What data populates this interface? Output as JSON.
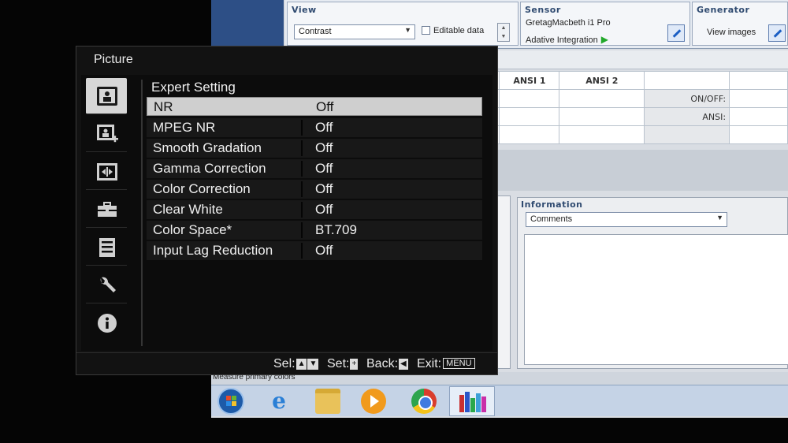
{
  "pc_app": {
    "view_group_title": "View",
    "view_select": "Contrast",
    "editable_label": "Editable data",
    "sensor_group_title": "Sensor",
    "sensor_name": "GretagMacbeth i1 Pro",
    "sensor_mode": "Adative Integration",
    "generator_group_title": "Generator",
    "view_images_label": "View images",
    "grid_headers": [
      "ANSI 1",
      "ANSI 2"
    ],
    "grid_label_onoff": "ON/OFF:",
    "grid_label_ansi": "ANSI:",
    "information_title": "Information",
    "comments_select": "Comments",
    "status_text": "Measure primary colors"
  },
  "taskbar": {
    "icons": [
      "windows-start-icon",
      "internet-explorer-icon",
      "folder-icon",
      "media-player-icon",
      "chrome-icon",
      "calibration-app-icon"
    ]
  },
  "osd": {
    "title": "Picture",
    "section": "Expert Setting",
    "sidebar_icons": [
      "picture-icon",
      "picture-add-icon",
      "screen-size-icon",
      "toolbox-icon",
      "checklist-icon",
      "wrench-icon",
      "info-icon"
    ],
    "items": [
      {
        "label": "NR",
        "value": "Off"
      },
      {
        "label": "MPEG NR",
        "value": "Off"
      },
      {
        "label": "Smooth Gradation",
        "value": "Off"
      },
      {
        "label": "Gamma Correction",
        "value": "Off"
      },
      {
        "label": "Color Correction",
        "value": "Off"
      },
      {
        "label": "Clear White",
        "value": "Off"
      },
      {
        "label": "Color Space*",
        "value": "BT.709"
      },
      {
        "label": "Input Lag Reduction",
        "value": "Off"
      }
    ],
    "selected_index": 0,
    "footer": {
      "sel": "Sel:",
      "set": "Set:",
      "back": "Back:",
      "exit": "Exit:",
      "menu_key": "MENU"
    }
  }
}
